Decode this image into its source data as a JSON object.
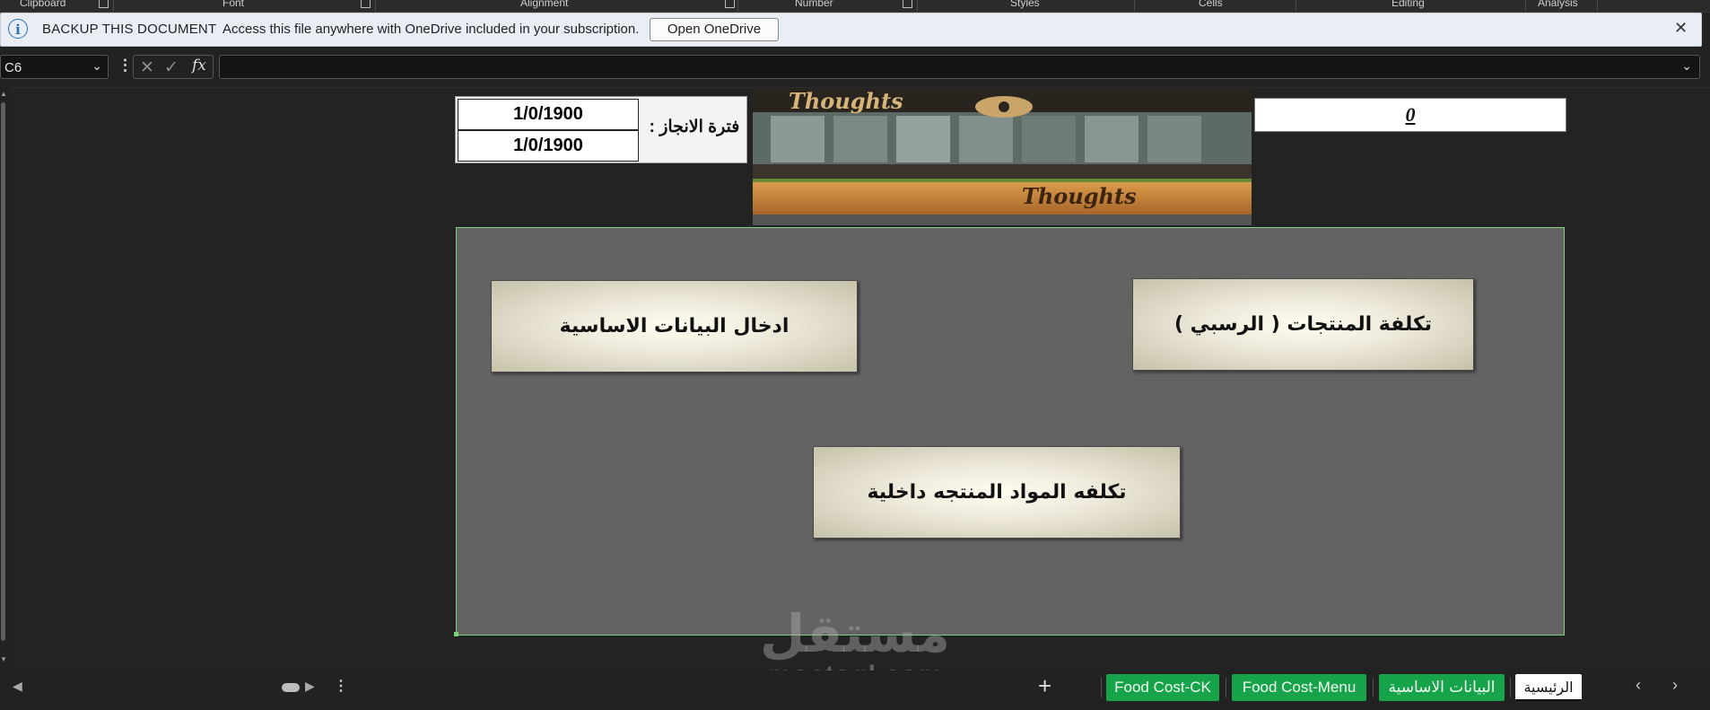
{
  "ribbon_groups": [
    {
      "label": "Clipboard"
    },
    {
      "label": "Font"
    },
    {
      "label": "Alignment"
    },
    {
      "label": "Number"
    },
    {
      "label": "Styles"
    },
    {
      "label": "Cells"
    },
    {
      "label": "Editing"
    },
    {
      "label": "Analysis"
    }
  ],
  "infobar": {
    "icon": "info-icon",
    "icon_glyph": "i",
    "title": "BACKUP THIS DOCUMENT",
    "message": "Access this file anywhere with OneDrive included in your subscription.",
    "button_label": "Open OneDrive",
    "close_glyph": "✕",
    "accent_color": "#2a6fb8"
  },
  "formula_bar": {
    "name_box": "C6",
    "dropdown_glyph": "⌄",
    "more_glyph": "⋮",
    "cancel_glyph": "✕",
    "enter_glyph": "✓",
    "fx_label": "fx",
    "formula": "",
    "expand_glyph": "⌄"
  },
  "sheet": {
    "dates": [
      "1/0/1900",
      "1/0/1900"
    ],
    "period_label": "فترة الانجاز :",
    "photo_sign_text": "Thoughts",
    "total_value": "0",
    "buttons": {
      "basic_data": "ادخال البيانات الاساسية",
      "product_cost": "تكلفة المنتجات ( الرسبي )",
      "internal_cost": "تكلفه المواد المنتجه داخلية"
    },
    "panel_color": "#636363",
    "selection_color": "#7fd07f"
  },
  "watermark": {
    "arabic": "مستقل",
    "latin": "mostaql.com"
  },
  "tabs": {
    "add_glyph": "+",
    "prev_glyph": "‹",
    "next_glyph": "›",
    "more_glyph": "⋮",
    "items": [
      {
        "label": "Food Cost-CK",
        "active": false
      },
      {
        "label": "Food Cost-Menu",
        "active": false
      },
      {
        "label": "البيانات الاساسية",
        "active": false
      },
      {
        "label": "الرئيسية",
        "active": true
      }
    ],
    "tab_color": "#16a34a"
  }
}
